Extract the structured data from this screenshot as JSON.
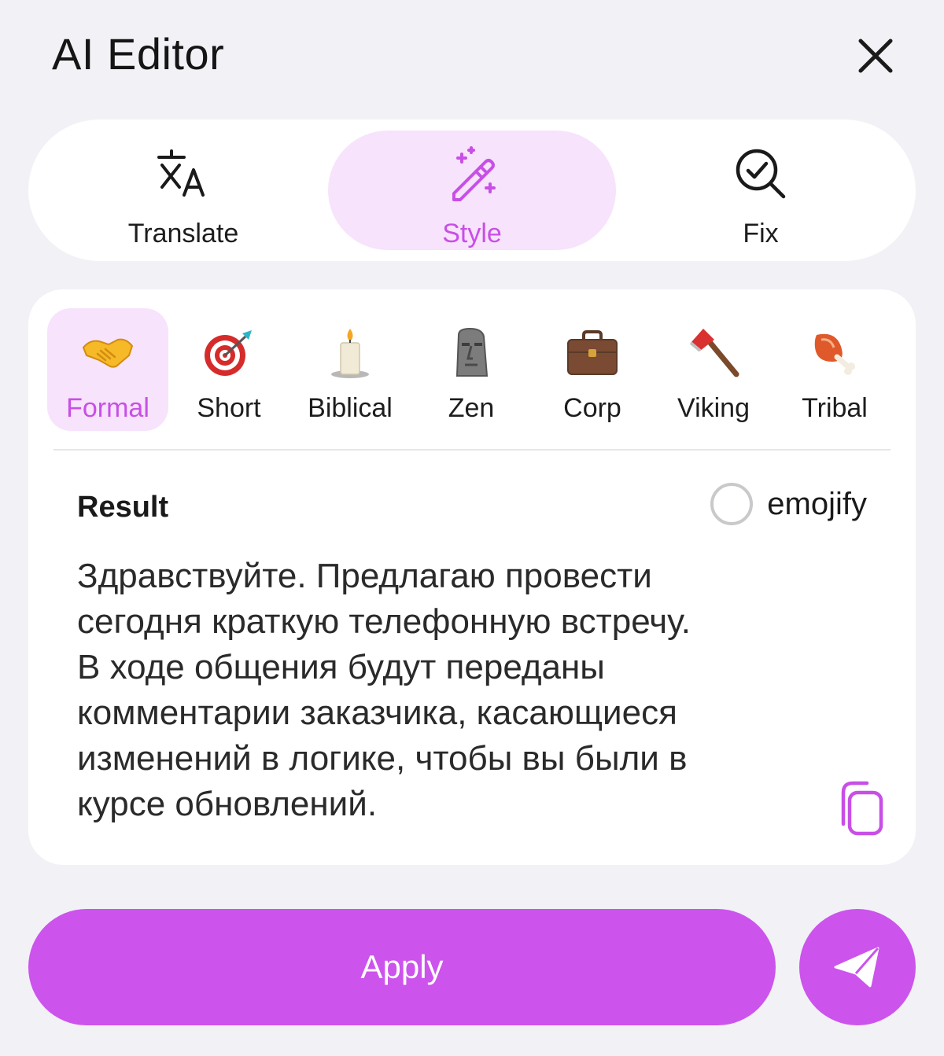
{
  "header": {
    "title": "AI Editor"
  },
  "modes": [
    {
      "label": "Translate",
      "icon": "translate-icon"
    },
    {
      "label": "Style",
      "icon": "magic-wand-icon",
      "active": true
    },
    {
      "label": "Fix",
      "icon": "search-check-icon"
    }
  ],
  "styles": [
    {
      "label": "Formal",
      "icon": "handshake-icon",
      "active": true
    },
    {
      "label": "Short",
      "icon": "target-dart-icon"
    },
    {
      "label": "Biblical",
      "icon": "candle-icon"
    },
    {
      "label": "Zen",
      "icon": "moai-icon"
    },
    {
      "label": "Corp",
      "icon": "briefcase-icon"
    },
    {
      "label": "Viking",
      "icon": "axe-icon"
    },
    {
      "label": "Tribal",
      "icon": "meat-on-bone-icon"
    }
  ],
  "result": {
    "label": "Result",
    "emojify_label": "emojify",
    "emojify_checked": false,
    "text_lines": [
      "Здравствуйте. Предлагаю провести",
      "сегодня краткую телефонную встречу.",
      "В ходе общения будут переданы",
      "комментарии заказчика, касающиеся",
      "изменений в логике, чтобы вы были в",
      "курсе обновлений."
    ]
  },
  "actions": {
    "apply_label": "Apply"
  },
  "colors": {
    "accent": "#cc53ec",
    "accent_soft": "#f7e3fb",
    "background": "#f1f1f6"
  }
}
